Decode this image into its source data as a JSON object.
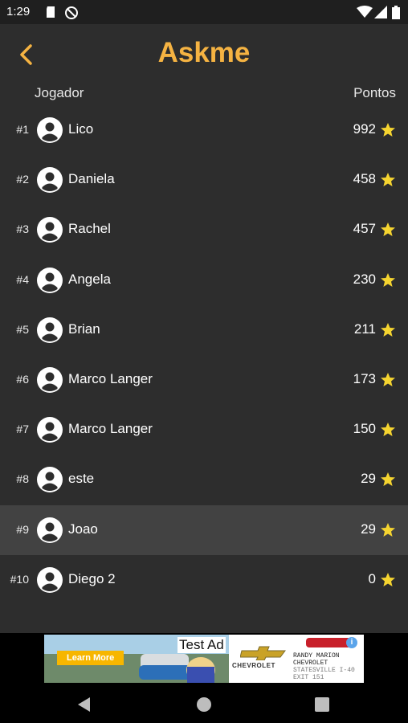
{
  "status": {
    "time": "1:29"
  },
  "appbar": {
    "title": "Askme"
  },
  "columns": {
    "player": "Jogador",
    "points": "Pontos"
  },
  "rows": [
    {
      "rank": "#1",
      "name": "Lico",
      "points": "992"
    },
    {
      "rank": "#2",
      "name": "Daniela",
      "points": "458"
    },
    {
      "rank": "#3",
      "name": "Rachel",
      "points": "457"
    },
    {
      "rank": "#4",
      "name": "Angela",
      "points": "230"
    },
    {
      "rank": "#5",
      "name": "Brian",
      "points": "211"
    },
    {
      "rank": "#6",
      "name": "Marco Langer",
      "points": "173"
    },
    {
      "rank": "#7",
      "name": "Marco Langer",
      "points": "150"
    },
    {
      "rank": "#8",
      "name": "este",
      "points": "29"
    },
    {
      "rank": "#9",
      "name": "Joao",
      "points": "29"
    },
    {
      "rank": "#10",
      "name": "Diego 2",
      "points": "0"
    }
  ],
  "highlighted_rank": "#9",
  "ad": {
    "label": "Test Ad",
    "cta": "Learn More",
    "brand": "CHEVROLET",
    "dealer_line1": "RANDY MARION",
    "dealer_line2": "CHEVROLET",
    "dealer_line3": "STATESVILLE I-40",
    "dealer_line4": "EXIT 151",
    "info": "i"
  },
  "colors": {
    "accent": "#f5b342",
    "background": "#2d2d2d",
    "highlight": "#424242",
    "star": "#f5d430"
  },
  "icons": {
    "back": "chevron-left-icon",
    "avatar": "account-circle-icon",
    "star": "star-icon",
    "nav_back": "triangle-back-icon",
    "nav_home": "circle-home-icon",
    "nav_recents": "square-recents-icon"
  }
}
